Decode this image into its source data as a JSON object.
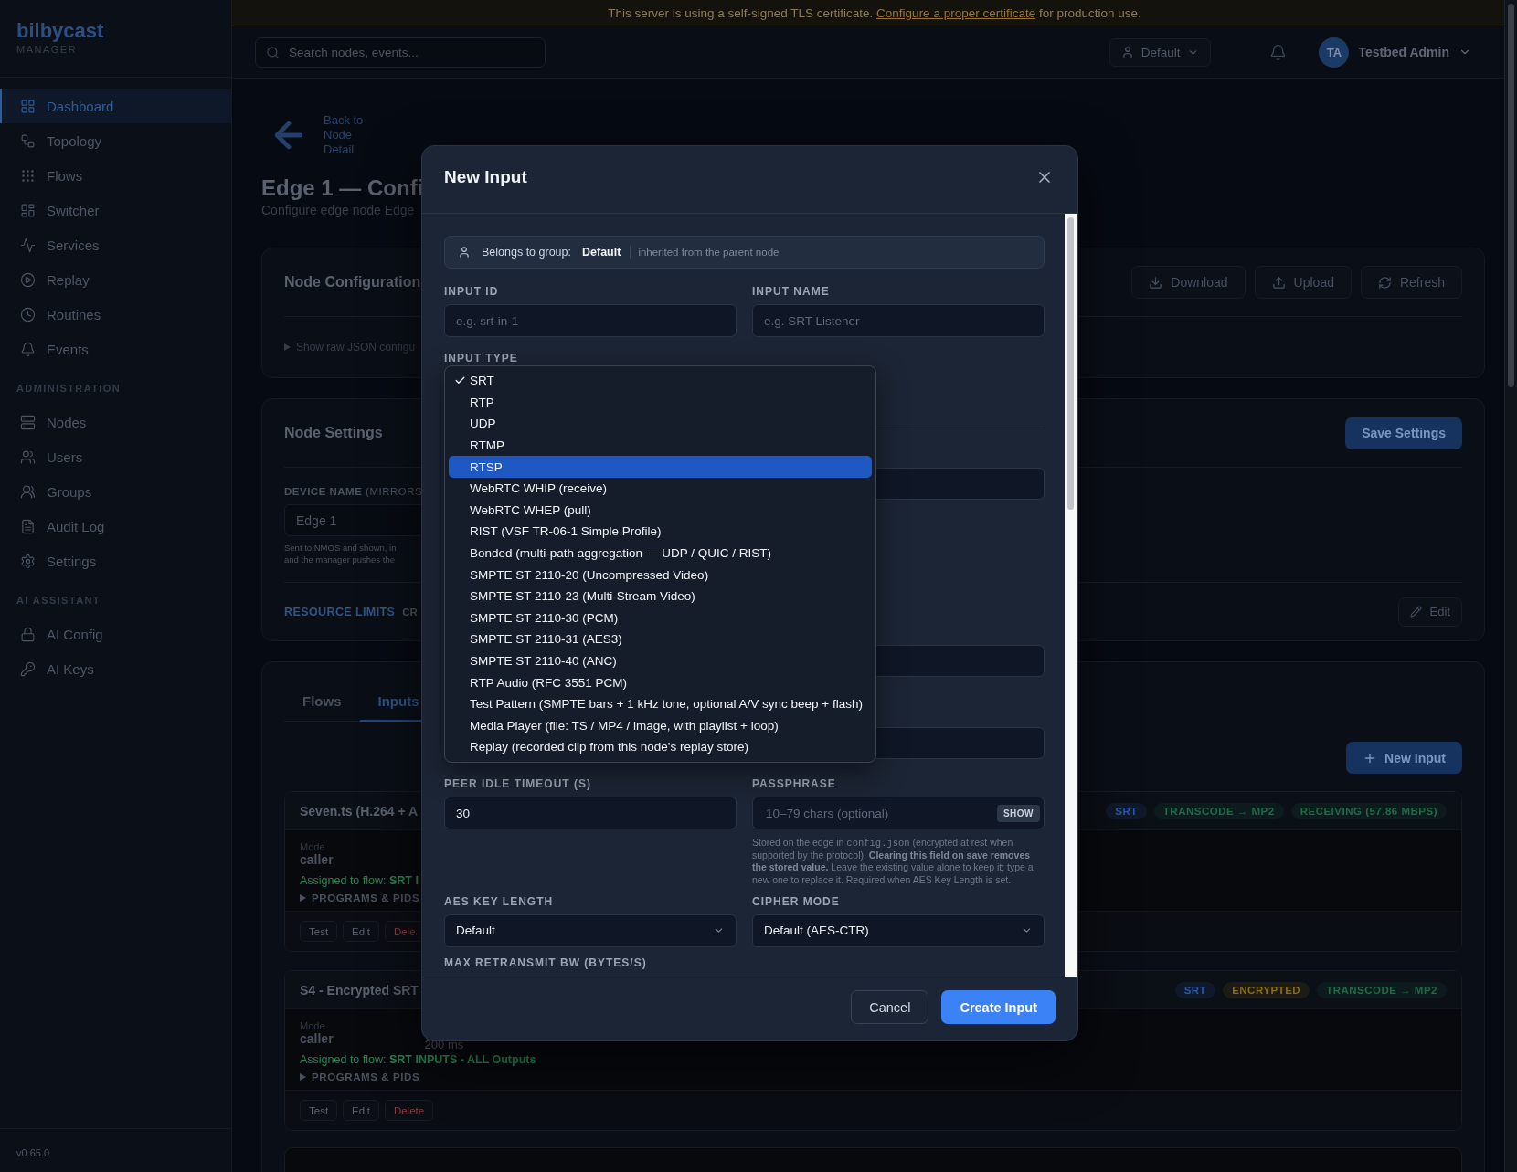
{
  "banner": {
    "text": "This server is using a self-signed TLS certificate.",
    "link": "Configure a proper certificate",
    "suffix": "for production use."
  },
  "sidebar": {
    "logo": "bilbycast",
    "subtitle": "MANAGER",
    "version": "v0.65.0",
    "sections": [
      {
        "items": [
          {
            "label": "Dashboard",
            "selected": true
          },
          {
            "label": "Topology",
            "selected": false
          },
          {
            "label": "Flows",
            "selected": false
          },
          {
            "label": "Switcher",
            "selected": false
          },
          {
            "label": "Services",
            "selected": false
          },
          {
            "label": "Replay",
            "selected": false
          },
          {
            "label": "Routines",
            "selected": false
          },
          {
            "label": "Events",
            "selected": false
          }
        ]
      },
      {
        "title": "ADMINISTRATION",
        "items": [
          {
            "label": "Nodes",
            "selected": false
          },
          {
            "label": "Users",
            "selected": false
          },
          {
            "label": "Groups",
            "selected": false
          },
          {
            "label": "Audit Log",
            "selected": false
          },
          {
            "label": "Settings",
            "selected": false
          }
        ]
      },
      {
        "title": "AI ASSISTANT",
        "items": [
          {
            "label": "AI Config",
            "selected": false
          },
          {
            "label": "AI Keys",
            "selected": false
          }
        ]
      }
    ]
  },
  "header": {
    "search_placeholder": "Search nodes, events...",
    "group": "Default",
    "avatar": "TA",
    "user": "Testbed Admin"
  },
  "page": {
    "back": "Back to Node Detail",
    "title": "Edge 1 — Confi",
    "subtitle": "Configure edge node Edge",
    "node_configuration": {
      "title": "Node Configuration",
      "buttons": [
        "Download",
        "Upload",
        "Refresh"
      ],
      "raw_toggle": "Show raw JSON configu"
    },
    "node_settings": {
      "title": "Node Settings",
      "save": "Save Settings",
      "device_label": "DEVICE NAME",
      "device_hint": "(MIRRORS",
      "device_value": "Edge 1",
      "help": [
        "Sent to NMOS and shown, in",
        "and the manager pushes the"
      ],
      "resource_limits": "RESOURCE LIMITS",
      "resource_cut": "CR",
      "edit": "Edit"
    },
    "tabs": [
      {
        "label": "Flows",
        "selected": false
      },
      {
        "label": "Inputs",
        "selected": true
      }
    ],
    "new_input": "New Input",
    "inputs": [
      {
        "title": "Seven.ts (H.264 + A",
        "badges": [
          {
            "text": "SRT",
            "color": "#2b5aa6"
          },
          {
            "text": "TRANSCODE → MP2",
            "color": "#1f6b47"
          },
          {
            "text": "RECEIVING (57.86 MBPS)",
            "color": "#1f6b47"
          }
        ],
        "mode_label": "Mode",
        "mode": "caller",
        "assigned": "Assigned to flow: **SRT I**",
        "programs": "PROGRAMS & PIDS",
        "actions": [
          "Test",
          "Edit",
          "Dele"
        ]
      },
      {
        "title": "S4 - Encrypted SRT",
        "badges": [
          {
            "text": "SRT",
            "color": "#2b5aa6"
          },
          {
            "text": "ENCRYPTED",
            "color": "#8a6d12"
          },
          {
            "text": "TRANSCODE → MP2",
            "color": "#1f6b47"
          }
        ],
        "mode_label": "Mode",
        "mode": "caller",
        "column_2": "200 ms",
        "assigned": "Assigned to flow: **SRT INPUTS - ALL Outputs**",
        "programs": "PROGRAMS & PIDS",
        "actions": [
          "Test",
          "Edit",
          "Delete"
        ]
      }
    ]
  },
  "modal": {
    "title": "New Input",
    "group": {
      "label": "Belongs to group:",
      "value": "Default",
      "note": "inherited from the parent node"
    },
    "input_id": {
      "label": "INPUT ID",
      "placeholder": "e.g. srt-in-1"
    },
    "input_name": {
      "label": "INPUT NAME",
      "placeholder": "e.g. SRT Listener"
    },
    "input_type": {
      "label": "INPUT TYPE",
      "options": [
        {
          "label": "SRT",
          "selected": true,
          "highlighted": false
        },
        {
          "label": "RTP",
          "selected": false,
          "highlighted": false
        },
        {
          "label": "UDP",
          "selected": false,
          "highlighted": false
        },
        {
          "label": "RTMP",
          "selected": false,
          "highlighted": false
        },
        {
          "label": "RTSP",
          "selected": false,
          "highlighted": true
        },
        {
          "label": "WebRTC WHIP (receive)",
          "selected": false,
          "highlighted": false
        },
        {
          "label": "WebRTC WHEP (pull)",
          "selected": false,
          "highlighted": false
        },
        {
          "label": "RIST (VSF TR-06-1 Simple Profile)",
          "selected": false,
          "highlighted": false
        },
        {
          "label": "Bonded (multi-path aggregation — UDP / QUIC / RIST)",
          "selected": false,
          "highlighted": false
        },
        {
          "label": "SMPTE ST 2110-20 (Uncompressed Video)",
          "selected": false,
          "highlighted": false
        },
        {
          "label": "SMPTE ST 2110-23 (Multi-Stream Video)",
          "selected": false,
          "highlighted": false
        },
        {
          "label": "SMPTE ST 2110-30 (PCM)",
          "selected": false,
          "highlighted": false
        },
        {
          "label": "SMPTE ST 2110-31 (AES3)",
          "selected": false,
          "highlighted": false
        },
        {
          "label": "SMPTE ST 2110-40 (ANC)",
          "selected": false,
          "highlighted": false
        },
        {
          "label": "RTP Audio (RFC 3551 PCM)",
          "selected": false,
          "highlighted": false
        },
        {
          "label": "Test Pattern (SMPTE bars + 1 kHz tone, optional A/V sync beep + flash)",
          "selected": false,
          "highlighted": false
        },
        {
          "label": "Media Player (file: TS / MP4 / image, with playlist + loop)",
          "selected": false,
          "highlighted": false
        },
        {
          "label": "Replay (recorded clip from this node's replay store)",
          "selected": false,
          "highlighted": false
        }
      ]
    },
    "peer_idle": {
      "label": "PEER IDLE TIMEOUT (S)",
      "value": "30"
    },
    "passphrase": {
      "label": "PASSPHRASE",
      "placeholder": "10–79 chars (optional)",
      "toggle": "SHOW",
      "help_before": "Stored on the edge in",
      "help_code": "config.json",
      "help_after": "(encrypted at rest when supported by the protocol). **Clearing this field on save removes the stored value.** Leave the existing value alone to keep it; type a new one to replace it. Required when AES Key Length is set."
    },
    "aes_key_length": {
      "label": "AES KEY LENGTH",
      "value": "Default"
    },
    "cipher_mode": {
      "label": "CIPHER MODE",
      "value": "Default (AES-CTR)"
    },
    "max_retransmit": {
      "label": "MAX RETRANSMIT BW (BYTES/S)"
    },
    "buttons": {
      "cancel": "Cancel",
      "create": "Create Input"
    }
  }
}
